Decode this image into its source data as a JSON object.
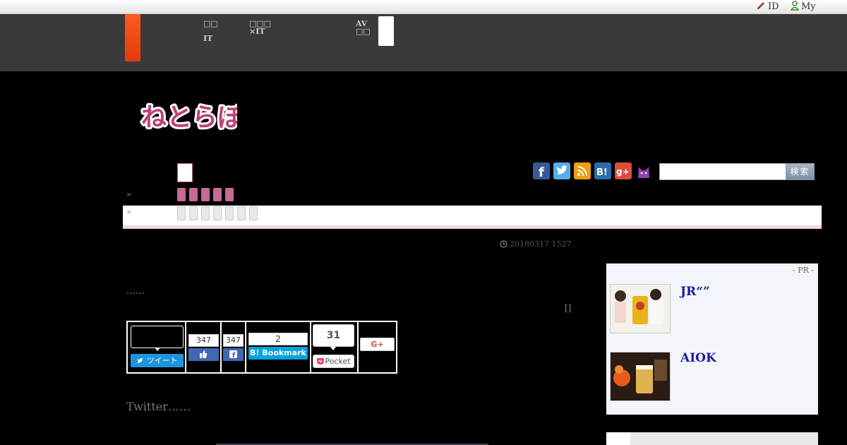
{
  "topbar": {
    "id_label": "ID",
    "my_label": "My"
  },
  "nav": {
    "item1_line1": "□□",
    "item1_line2": "IT",
    "item2_line1": "□□□",
    "item2_line2": "×IT",
    "item3_line1": "AV",
    "item3_line2": "□□"
  },
  "logo": {
    "text": "ねとらぼ"
  },
  "breadcrumb": {
    "chevron1": "»",
    "chevron2": "»"
  },
  "search": {
    "button_label": "検索",
    "value": ""
  },
  "social_icons": [
    "facebook-icon",
    "twitter-icon",
    "rss-icon",
    "hatena-icon",
    "google-plus-icon",
    "cat-icon"
  ],
  "article": {
    "date": "20180317 1527",
    "intro_dots": "……",
    "bracket": "[]",
    "twitter_line": "Twitter……"
  },
  "share": {
    "tweet_label": "ツイート",
    "fb_like_count": "347",
    "fb_share_count": "347",
    "hatena_count": "2",
    "hatena_label": "Bookmark",
    "pocket_count": "31",
    "pocket_label": "Pocket",
    "gplus_label": "G+"
  },
  "pr": {
    "label": "- PR -",
    "items": [
      {
        "title": "JR“”"
      },
      {
        "title": "AIOK"
      }
    ]
  },
  "colors": {
    "accent": "#e8481a",
    "logo_pink": "#c0407a",
    "link_blue": "#1a1aa8"
  }
}
